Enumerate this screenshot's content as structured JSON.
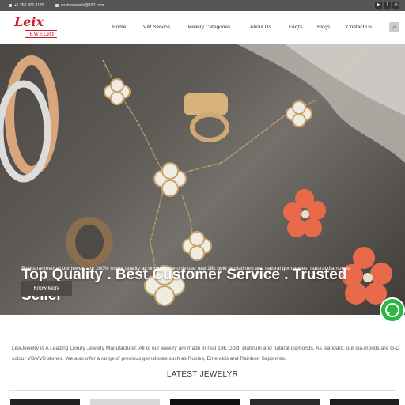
{
  "topbar": {
    "phone": "+1 262 806 8175",
    "email": "customjewels@163.com",
    "social_icons": [
      "youtube-icon",
      "rss-icon",
      "instagram-icon"
    ]
  },
  "header": {
    "logo_script": "Leix",
    "logo_word": "JEWELRY",
    "nav": [
      "Home",
      "VIP Service",
      "Jewelry Categories",
      "About Us",
      "FAQ's",
      "Blogs",
      "Contact Us"
    ],
    "search_icon": "search-icon"
  },
  "hero": {
    "title": "Top Quality . Best Customer Service . Trusted Seller",
    "subtitle": "To guaranteed all our jewels are 100% mirror quality as original, We only use real 18k gold or platinum and natural gemstones, natural diamonds.",
    "button": "Know More"
  },
  "intro": {
    "text": "LeixJewelry is A Leading Luxury Jewelry Manufacturer. All of our jewelry are made in real 18K Gold, platinum and natural diamonds. As standard, our dia-monds are G-D colour VS/VVS stones. We also offer a range of precious gemstones such as Rubies, Emeralds and Rainbow Sapphires."
  },
  "latest": {
    "heading": "LATEST JEWELYR"
  },
  "colors": {
    "topbar": "#555555",
    "brand_red": "#c9212e",
    "whatsapp": "#2bb741"
  }
}
